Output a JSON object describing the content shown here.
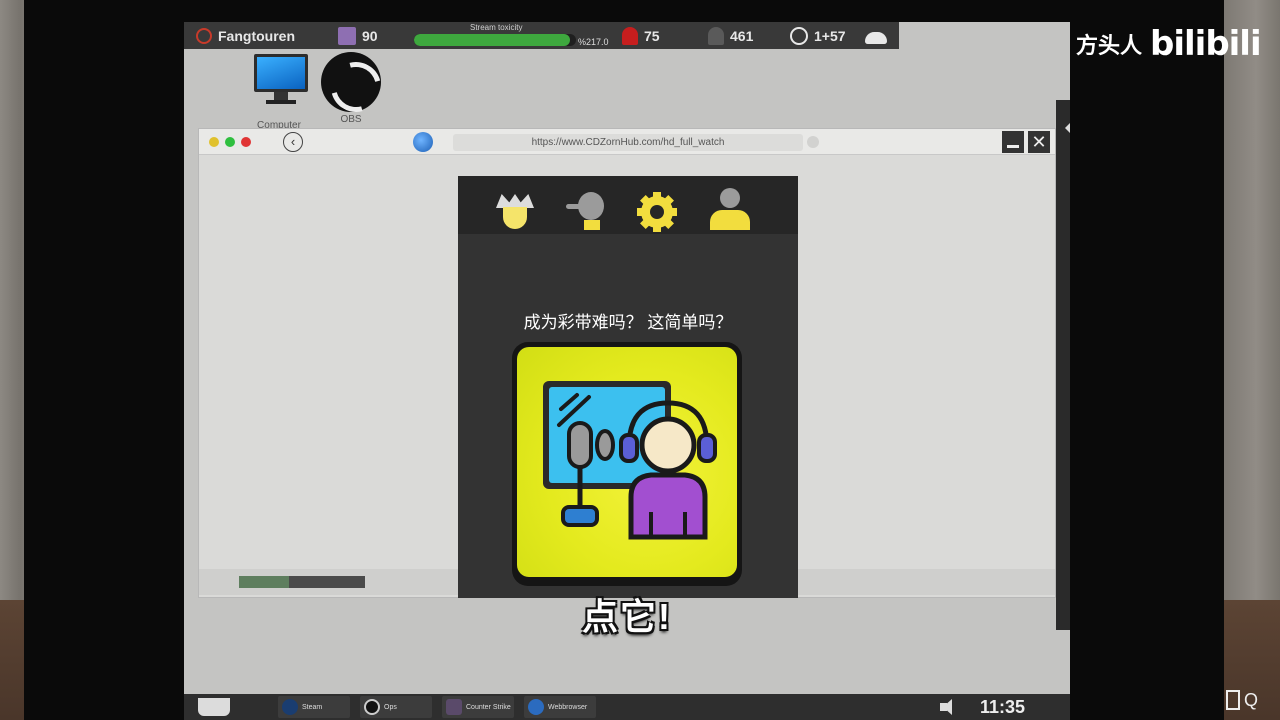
{
  "hud": {
    "channel_name": "Fangtouren",
    "emote_count": "90",
    "toxicity_label": "Stream toxicity",
    "toxicity_value": "%217.0",
    "toxicity_fill": 0.96,
    "viewers": "75",
    "followers": "461",
    "day_time": "1+57"
  },
  "desktop": {
    "icons": [
      {
        "label": "Computer",
        "icon": "computer-icon"
      },
      {
        "label": "OBS",
        "icon": "obs-icon"
      }
    ]
  },
  "browser": {
    "url": "https://www.CDZornHub.com/hd_full_watch",
    "close_glyph": "✕",
    "back_glyph": "‹",
    "video_progress": 0.4
  },
  "popup": {
    "tabs": [
      {
        "name": "jester-icon"
      },
      {
        "name": "head-profile-icon"
      },
      {
        "name": "gear-icon"
      },
      {
        "name": "user-icon"
      }
    ],
    "question": "成为彩带难吗？ 这简单吗？",
    "card_icon": "streamer-microphone-headset-icon"
  },
  "subtitle": "点它!",
  "taskbar": {
    "apps": [
      {
        "label": "Steam",
        "icon": "steam-icon"
      },
      {
        "label": "Ops",
        "icon": "obs-icon"
      },
      {
        "label": "Counter Strike",
        "icon": "counter-strike-icon"
      },
      {
        "label": "Webbrowser",
        "icon": "globe-icon"
      }
    ],
    "clock": "11:35"
  },
  "watermark": {
    "author": "方头人",
    "logo": "bilibili"
  },
  "colors": {
    "accent_yellow": "#f2dd3e",
    "toxicity_green": "#3ea83e",
    "viewer_red": "#c61e1e",
    "popup_bg": "#333333"
  }
}
